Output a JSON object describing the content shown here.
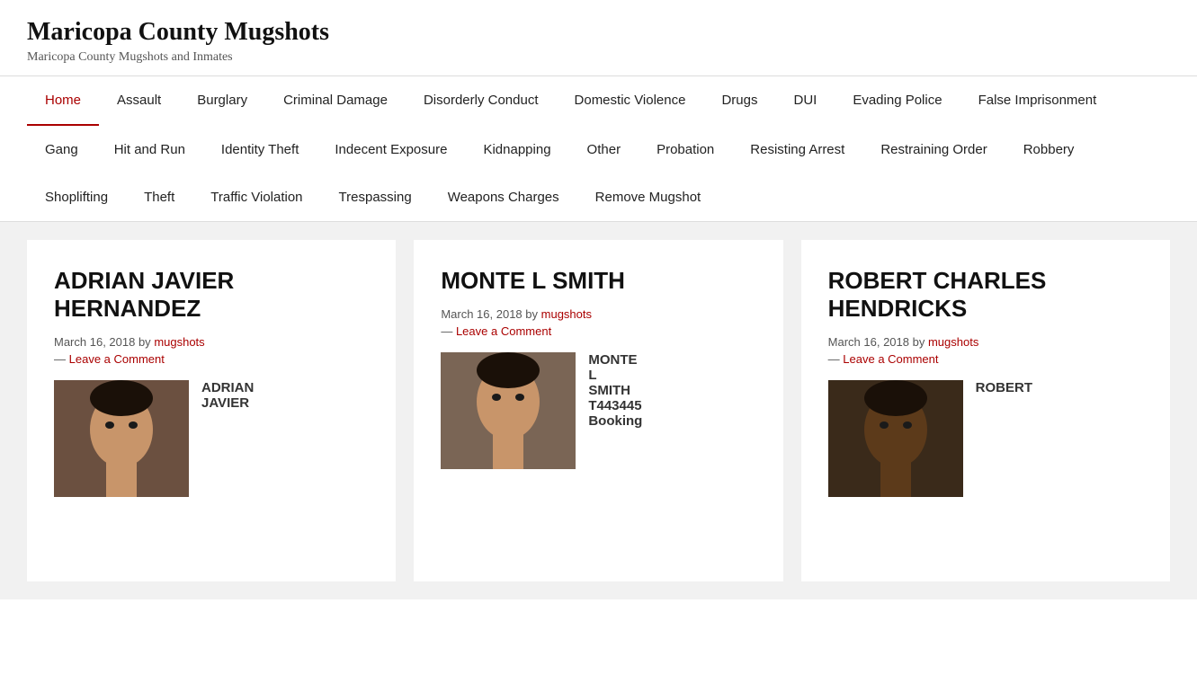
{
  "site": {
    "title": "Maricopa County Mugshots",
    "subtitle": "Maricopa County Mugshots and Inmates"
  },
  "nav": {
    "items": [
      {
        "label": "Home",
        "active": true
      },
      {
        "label": "Assault",
        "active": false
      },
      {
        "label": "Burglary",
        "active": false
      },
      {
        "label": "Criminal Damage",
        "active": false
      },
      {
        "label": "Disorderly Conduct",
        "active": false
      },
      {
        "label": "Domestic Violence",
        "active": false
      },
      {
        "label": "Drugs",
        "active": false
      },
      {
        "label": "DUI",
        "active": false
      },
      {
        "label": "Evading Police",
        "active": false
      },
      {
        "label": "False Imprisonment",
        "active": false
      },
      {
        "label": "Gang",
        "active": false
      },
      {
        "label": "Hit and Run",
        "active": false
      },
      {
        "label": "Identity Theft",
        "active": false
      },
      {
        "label": "Indecent Exposure",
        "active": false
      },
      {
        "label": "Kidnapping",
        "active": false
      },
      {
        "label": "Other",
        "active": false
      },
      {
        "label": "Probation",
        "active": false
      },
      {
        "label": "Resisting Arrest",
        "active": false
      },
      {
        "label": "Restraining Order",
        "active": false
      },
      {
        "label": "Robbery",
        "active": false
      },
      {
        "label": "Shoplifting",
        "active": false
      },
      {
        "label": "Theft",
        "active": false
      },
      {
        "label": "Traffic Violation",
        "active": false
      },
      {
        "label": "Trespassing",
        "active": false
      },
      {
        "label": "Weapons Charges",
        "active": false
      },
      {
        "label": "Remove Mugshot",
        "active": false
      }
    ]
  },
  "cards": [
    {
      "id": "card-1",
      "title": "ADRIAN JAVIER HERNANDEZ",
      "date": "March 16, 2018",
      "by": "by",
      "author": "mugshots",
      "comment_sep": "—",
      "comment_link": "Leave a Comment",
      "mugshot_text": "ADRIAN JAVIER",
      "face_color": "#6b5040"
    },
    {
      "id": "card-2",
      "title": "MONTE L SMITH",
      "date": "March 16, 2018",
      "by": "by",
      "author": "mugshots",
      "comment_sep": "—",
      "comment_link": "Leave a Comment",
      "mugshot_text": "MONTE L SMITH T443445 Booking",
      "face_color": "#7a6555"
    },
    {
      "id": "card-3",
      "title": "ROBERT CHARLES HENDRICKS",
      "date": "March 16, 2018",
      "by": "by",
      "author": "mugshots",
      "comment_sep": "—",
      "comment_link": "Leave a Comment",
      "mugshot_text": "ROBERT",
      "face_color": "#3a2a1a"
    }
  ]
}
